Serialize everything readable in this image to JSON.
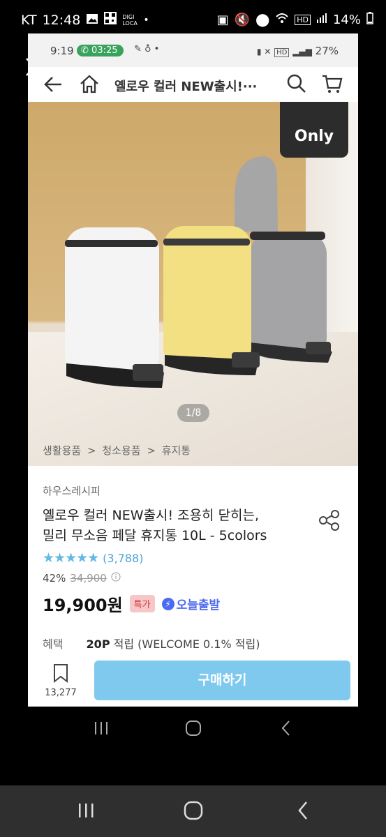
{
  "outer_status": {
    "carrier": "KT",
    "time": "12:48",
    "digi_label": "DIGI LOCA",
    "battery": "14%"
  },
  "inner_status": {
    "time": "9:19",
    "call_time": "03:25",
    "battery": "27%",
    "hd": "HD"
  },
  "appbar": {
    "title": "옐로우 컬러 NEW출시!···"
  },
  "hero": {
    "badge": "Only",
    "counter": "1/8"
  },
  "breadcrumb": [
    "생활용품",
    "청소용품",
    "휴지통"
  ],
  "product": {
    "brand": "하우스레시피",
    "title_line1": "옐로우 컬러 NEW출시! 조용히 닫히는,",
    "title_line2": "밀리 무소음 페달 휴지통 10L - 5colors",
    "rating_count": "(3,788)",
    "rating_stars": 5,
    "discount": "42%",
    "original_price": "34,900",
    "price": "19,900원",
    "special_tag": "특가",
    "delivery": "오늘출발"
  },
  "benefit": {
    "label": "혜택",
    "points": "20P",
    "detail": "적립 (WELCOME 0.1% 적립)"
  },
  "bottom": {
    "bookmark_count": "13,277",
    "buy_label": "구매하기"
  },
  "colors": {
    "accent": "#7fc8ee",
    "star": "#63b9e6",
    "delivery": "#4d6bf0",
    "call": "#3aa35b"
  }
}
